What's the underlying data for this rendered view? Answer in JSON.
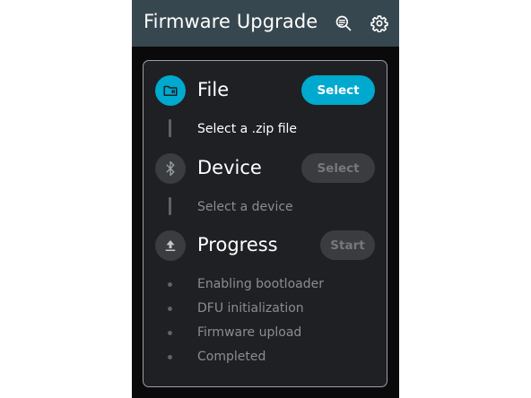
{
  "appbar": {
    "title": "Firmware Upgrade",
    "icons": [
      "search-logs-icon",
      "gear-icon"
    ]
  },
  "colors": {
    "appbar_bg": "#37474f",
    "accent": "#00a9ce",
    "card_bg": "#1e2024",
    "disabled_button": "#3a3c40"
  },
  "steps": {
    "file": {
      "title": "File",
      "icon": "folder-icon",
      "button_label": "Select",
      "button_state": "active",
      "status": "Select a .zip file"
    },
    "device": {
      "title": "Device",
      "icon": "bluetooth-icon",
      "button_label": "Select",
      "button_state": "disabled",
      "status": "Select a device"
    },
    "progress": {
      "title": "Progress",
      "icon": "upload-icon",
      "button_label": "Start",
      "button_state": "disabled",
      "stages": [
        "Enabling bootloader",
        "DFU initialization",
        "Firmware upload",
        "Completed"
      ]
    }
  }
}
